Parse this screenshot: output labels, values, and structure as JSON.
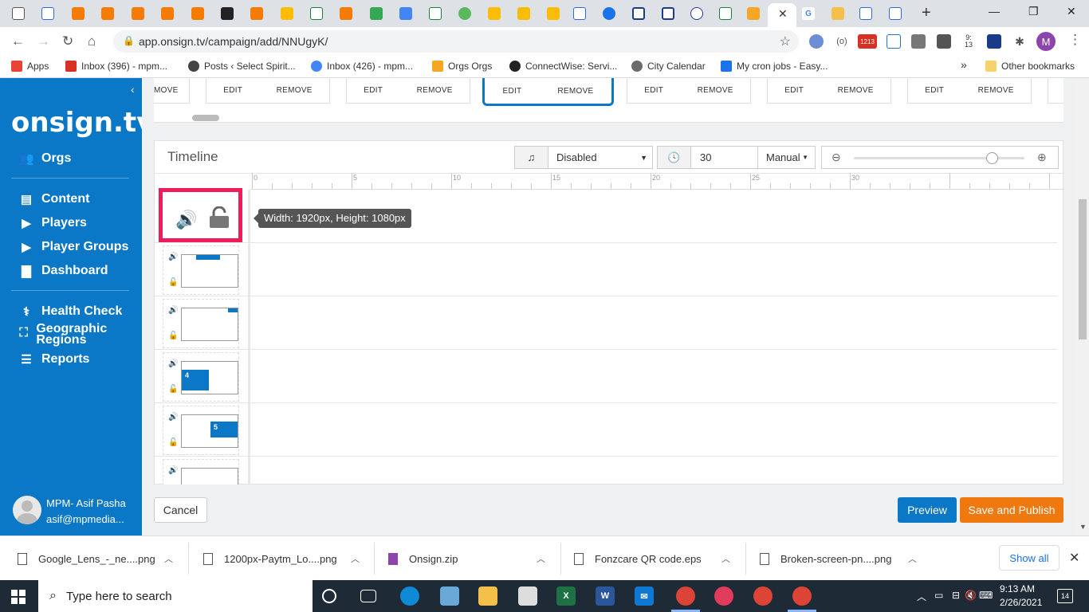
{
  "browser": {
    "url": "app.onsign.tv/campaign/add/NNUgyK/",
    "profile_initial": "M",
    "ext_badges": {
      "mail": "1213",
      "sched_top": "9:",
      "sched_bottom": "13"
    }
  },
  "bookmarks": [
    {
      "label": "Apps",
      "color": "#ea4335"
    },
    {
      "label": "Inbox (396) - mpm...",
      "color": "#d93025"
    },
    {
      "label": "Posts ‹ Select Spirit...",
      "color": "#444444"
    },
    {
      "label": "Inbox (426) - mpm...",
      "color": "#4285f4"
    },
    {
      "label": "Orgs Orgs",
      "color": "#f5a623"
    },
    {
      "label": "ConnectWise: Servi...",
      "color": "#222222"
    },
    {
      "label": "City Calendar",
      "color": "#6b6b6b"
    },
    {
      "label": "My cron jobs - Easy...",
      "color": "#1a73e8"
    }
  ],
  "bookmarks_more": "»",
  "other_bookmarks": "Other bookmarks",
  "sidebar": {
    "logo": "onsign.tv",
    "nav_group1": [
      {
        "label": "Orgs",
        "icon": "users-icon",
        "glyph": "👥"
      }
    ],
    "nav_group2": [
      {
        "label": "Content",
        "icon": "content-icon",
        "glyph": "▤"
      },
      {
        "label": "Players",
        "icon": "play-icon",
        "glyph": "▶"
      },
      {
        "label": "Player Groups",
        "icon": "play-group-icon",
        "glyph": "▶"
      },
      {
        "label": "Dashboard",
        "icon": "bar-chart-icon",
        "glyph": "▇"
      }
    ],
    "nav_group3": [
      {
        "label": "Health Check",
        "icon": "stethoscope-icon",
        "glyph": "⚕"
      },
      {
        "label": "Geographic Regions",
        "icon": "map-marker-icon",
        "glyph": "⛶"
      },
      {
        "label": "Reports",
        "icon": "clipboard-icon",
        "glyph": "☰"
      }
    ],
    "user": {
      "name": "MPM- Asif Pasha",
      "email": "asif@mpmedia..."
    }
  },
  "cards": {
    "first_partial": "MOVE",
    "edit_label": "EDIT",
    "remove_label": "REMOVE"
  },
  "timeline": {
    "title": "Timeline",
    "audio_select": "Disabled",
    "duration": "30",
    "mode_select": "Manual",
    "zoom_level": 0.81,
    "ruler_labels": [
      "0",
      "5",
      "10",
      "15",
      "20",
      "25",
      "30"
    ],
    "tooltip": "Width: 1920px, Height: 1080px",
    "layers": [
      {
        "label": ""
      },
      {
        "label": ""
      },
      {
        "label": "4"
      },
      {
        "label": "5"
      },
      {
        "label": ""
      }
    ]
  },
  "actions": {
    "cancel": "Cancel",
    "preview": "Preview",
    "save_publish": "Save and Publish"
  },
  "downloads": {
    "items": [
      "Google_Lens_-_ne....png",
      "1200px-Paytm_Lo....png",
      "Onsign.zip",
      "Fonzcare QR code.eps",
      "Broken-screen-pn....png"
    ],
    "show_all": "Show all"
  },
  "taskbar": {
    "search_placeholder": "Type here to search",
    "time": "9:13 AM",
    "date": "2/26/2021",
    "notifications": "14"
  },
  "colors": {
    "brand_blue": "#0b77c7",
    "publish_orange": "#f0790f",
    "highlight_pink": "#ee1c5b"
  }
}
